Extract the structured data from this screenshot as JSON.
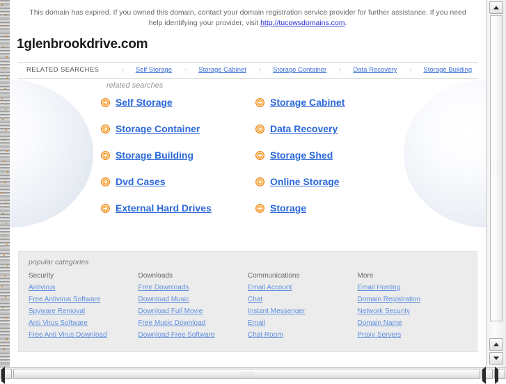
{
  "notice": {
    "text_before": "This domain has expired. If you owned this domain, contact your domain registration service provider for further assistance. If you need help identifying your provider, visit ",
    "link_text": "http://tucowsdomains.com",
    "text_after": "."
  },
  "domain_title": "1glenbrookdrive.com",
  "related_bar": {
    "label": "RELATED SEARCHES",
    "separator": "::",
    "items": [
      "Self Storage",
      "Storage Cabinet",
      "Storage Container",
      "Data Recovery",
      "Storage Building"
    ]
  },
  "main": {
    "caption": "related searches",
    "links": [
      "Self Storage",
      "Storage Cabinet",
      "Storage Container",
      "Data Recovery",
      "Storage Building",
      "Storage Shed",
      "Dvd Cases",
      "Online Storage",
      "External Hard Drives",
      "Storage"
    ]
  },
  "categories": {
    "caption": "popular categories",
    "columns": [
      {
        "heading": "Security",
        "links": [
          "Antivirus",
          "Free Antivirus Software",
          "Spyware Removal",
          "Anti Virus Software",
          "Free Anti Virus Download"
        ]
      },
      {
        "heading": "Downloads",
        "links": [
          "Free Downloads",
          "Download Music",
          "Download Full Movie",
          "Free Music Download",
          "Download Free Software"
        ]
      },
      {
        "heading": "Communications",
        "links": [
          "Email Account",
          "Chat",
          "Instant Messenger",
          "Email",
          "Chat Room"
        ]
      },
      {
        "heading": "More",
        "links": [
          "Email Hosting",
          "Domain Registration",
          "Network Security",
          "Domain Name",
          "Proxy Servers"
        ]
      }
    ]
  },
  "colors": {
    "link_blue": "#2b68d9",
    "nav_link_blue": "#3a6fd8",
    "cat_link_blue": "#5f8fe0",
    "arrow_orange": "#ef8b1f",
    "panel_gray": "#ececec"
  }
}
